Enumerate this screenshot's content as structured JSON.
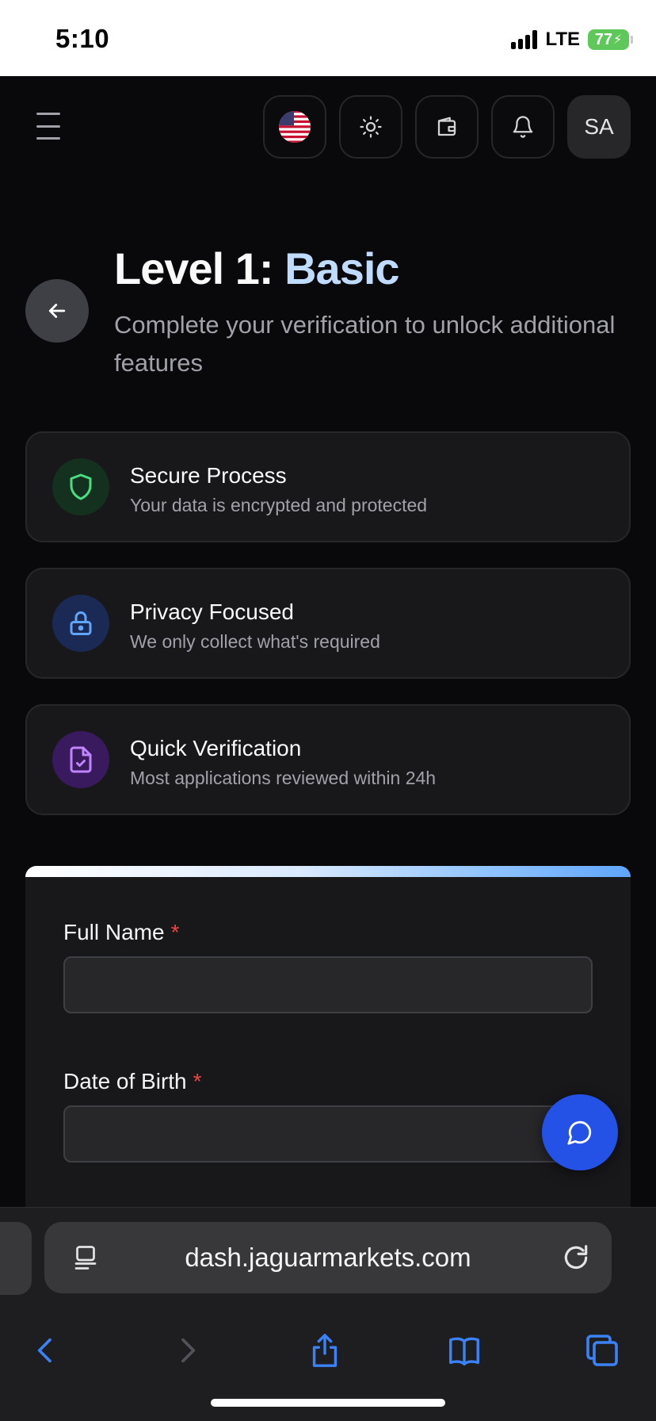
{
  "status_bar": {
    "time": "5:10",
    "network": "LTE",
    "battery": "77"
  },
  "header": {
    "icons": [
      "hamburger-menu-icon",
      "us-flag-icon",
      "sun-icon",
      "wallet-icon",
      "bell-icon"
    ],
    "avatar_initials": "SA"
  },
  "page": {
    "title_main": "Level 1: ",
    "title_accent": "Basic",
    "subtitle": "Complete your verification to unlock additional features"
  },
  "features": [
    {
      "title": "Secure Process",
      "description": "Your data is encrypted and protected",
      "icon": "shield-icon",
      "color": "#4ade80"
    },
    {
      "title": "Privacy Focused",
      "description": "We only collect what's required",
      "icon": "lock-icon",
      "color": "#60a5fa"
    },
    {
      "title": "Quick Verification",
      "description": "Most applications reviewed within 24h",
      "icon": "file-check-icon",
      "color": "#c084fc"
    }
  ],
  "form": {
    "full_name_label": "Full Name",
    "full_name_value": "",
    "dob_label": "Date of Birth",
    "dob_value": "",
    "required_marker": "*"
  },
  "browser": {
    "url": "dash.jaguarmarkets.com"
  },
  "colors": {
    "accent_blue": "#bfdbfe",
    "fab_blue": "#2451e6",
    "required_red": "#ef4444"
  }
}
